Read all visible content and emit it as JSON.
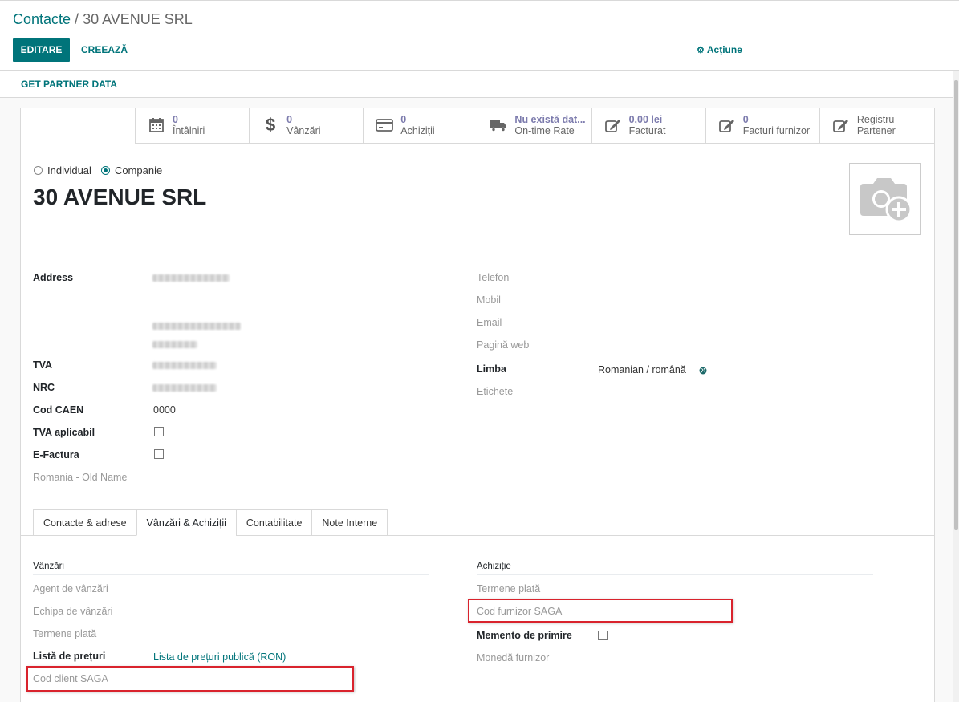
{
  "breadcrumb": {
    "parent": "Contacte",
    "separator": " / ",
    "current": "30 AVENUE SRL"
  },
  "toolbar": {
    "edit_label": "EDITARE",
    "create_label": "CREEAZĂ",
    "action_label": "Acțiune"
  },
  "header": {
    "get_partner_label": "GET PARTNER DATA"
  },
  "smart_buttons": [
    {
      "icon": "calendar-icon",
      "value": "0",
      "label": "Întâlniri"
    },
    {
      "icon": "dollar-icon",
      "value": "0",
      "label": "Vânzări"
    },
    {
      "icon": "credit-card-icon",
      "value": "0",
      "label": "Achiziții"
    },
    {
      "icon": "truck-icon",
      "value": "Nu există dat...",
      "label": "On-time Rate"
    },
    {
      "icon": "edit-icon",
      "value": "0,00 lei",
      "label": "Facturat"
    },
    {
      "icon": "edit-icon",
      "value": "0",
      "label": "Facturi furnizor"
    },
    {
      "icon": "edit-icon",
      "value": "Registru",
      "label": "Partener"
    }
  ],
  "company_type": {
    "individual_label": "Individual",
    "company_label": "Companie",
    "selected": "Companie"
  },
  "partner_name": "30 AVENUE SRL",
  "left_fields": {
    "address_label": "Address",
    "tva_label": "TVA",
    "nrc_label": "NRC",
    "caen_label": "Cod CAEN",
    "caen_value": "0000",
    "tva_aplicabil_label": "TVA aplicabil",
    "efactura_label": "E-Factura",
    "old_name_label": "Romania - Old Name"
  },
  "right_fields": {
    "telefon_label": "Telefon",
    "mobil_label": "Mobil",
    "email_label": "Email",
    "web_label": "Pagină web",
    "limba_label": "Limba",
    "limba_value": "Romanian / română",
    "etichete_label": "Etichete"
  },
  "tabs": [
    {
      "label": "Contacte & adrese",
      "active": false
    },
    {
      "label": "Vânzări & Achiziții",
      "active": true
    },
    {
      "label": "Contabilitate",
      "active": false
    },
    {
      "label": "Note Interne",
      "active": false
    }
  ],
  "sales": {
    "section_title": "Vânzări",
    "agent_label": "Agent de vânzări",
    "team_label": "Echipa de vânzări",
    "terms_label": "Termene plată",
    "pricelist_label": "Listă de prețuri",
    "pricelist_value": "Lista de prețuri publică (RON)",
    "saga_client_label": "Cod client SAGA"
  },
  "purchase": {
    "section_title": "Achiziție",
    "terms_label": "Termene plată",
    "saga_supplier_label": "Cod furnizor SAGA",
    "receipt_reminder_label": "Memento de primire",
    "currency_label": "Monedă furnizor"
  },
  "colors": {
    "primary": "#00747a",
    "stat_value": "#7c7bad",
    "highlight": "#d9232d"
  }
}
